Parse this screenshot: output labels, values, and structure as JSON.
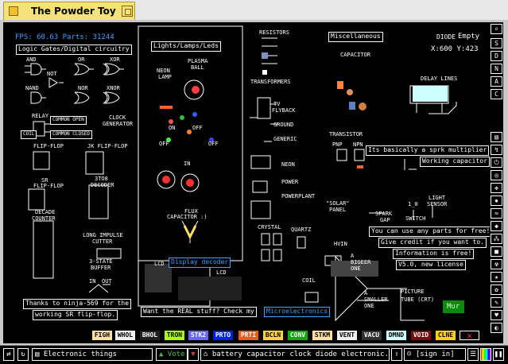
{
  "window": {
    "title": "The Powder Toy"
  },
  "hud": {
    "fps": "FPS: 60.63 Parts: 31244",
    "element_name": "DIODE",
    "hover": "Empty",
    "coords": "X:600 Y:423"
  },
  "labels": {
    "logic": "Logic Gates/Digital circuitry",
    "and": "AND",
    "not": "NOT",
    "or": "OR",
    "xor": "XOR",
    "nand": "NAND",
    "nor": "NOR",
    "xnor": "XNOR",
    "relay": "RELAY",
    "common_open": "COMMON OPEN",
    "common_closed": "COMMON CLOSED",
    "coil": "COIL",
    "clock": "CLOCK",
    "generator": "GENERATOR",
    "flipflop": "FLIP-FLOP",
    "jk": "JK FLIP-FLOP",
    "sr": "SR",
    "sr2": "FLIP-FLOP",
    "decoder": "3TO8",
    "decoder2": "DECODER",
    "decade": "DECADE",
    "decade2": "COUNTER",
    "long_impulse": "LONG IMPULSE",
    "cutter": "CUTTER",
    "tristate": "3-STATE",
    "buffer": "BUFFER",
    "in": "IN",
    "out": "OUT",
    "thanks": "Thanks to ninja-569 for the",
    "working_sr": "working SR flip-flop.",
    "lights": "Lights/Lamps/Leds",
    "neon_lamp": "NEON",
    "neon_lamp2": "LAMP",
    "plasma": "PLASMA",
    "plasma2": "BALL",
    "on": "ON",
    "off": "OFF",
    "flux": "FLUX",
    "flux2": "CAPACITOR :)",
    "lcd": "LCD",
    "display_decoder": "Display decoder",
    "want": "Want the REAL stuff? Check my",
    "micro": "Microelectronics",
    "resistors": "RESISTORS",
    "transformers": "TRANSFORMERS",
    "tv": "TV",
    "flyback": "FLYBACK",
    "ground": "GROUND",
    "generic": "GENERIC",
    "neon": "NEON",
    "power": "POWER",
    "powerplant": "POWERPLANT",
    "crystal": "CRYSTAL",
    "quartz": "QUARTZ",
    "misc": "Miscellaneous",
    "capacitor": "CAPACITOR",
    "delay": "DELAY LINES",
    "transistor": "TRANSISTOR",
    "pnp": "PNP",
    "npn": "NPN",
    "sprk": "Its basically a sprk multiplier",
    "working_cap": "Working capacitor",
    "solar": "\"SOLAR\"",
    "panel": "PANEL",
    "spark": "SPARK",
    "gap": "GAP",
    "switch": "SWITCH",
    "one_zero": "1_0",
    "light": "LIGHT",
    "sensor": "SENSOR",
    "free": "You can use any parts for free!",
    "credit": "Give credit if you want to.",
    "info": "Information is free!",
    "v5": "V5.0, new license",
    "hvin": "HVIN",
    "bigger": "A",
    "bigger2": "BIGEER",
    "bigger3": "ONE",
    "smaller": "A",
    "smaller2": "SMALLER",
    "smaller3": "ONE",
    "coil2": "COIL",
    "picture": "PICTURE",
    "tube": "TUBE (CRT)",
    "mur": "Mur"
  },
  "elements": [
    {
      "name": "FIGH",
      "bg": "#ffe0a0",
      "fg": "#000"
    },
    {
      "name": "WHOL",
      "bg": "#efefef",
      "fg": "#000"
    },
    {
      "name": "BHOL",
      "bg": "#202020",
      "fg": "#fff"
    },
    {
      "name": "TRON",
      "bg": "#a9ff00",
      "fg": "#000"
    },
    {
      "name": "STK2",
      "bg": "#6464ff",
      "fg": "#fff"
    },
    {
      "name": "PRTO",
      "bg": "#0020eb",
      "fg": "#fff"
    },
    {
      "name": "PRTI",
      "bg": "#eb5917",
      "fg": "#fff"
    },
    {
      "name": "BCLN",
      "bg": "#ffd040",
      "fg": "#000"
    },
    {
      "name": "CONV",
      "bg": "#0aab0a",
      "fg": "#fff"
    },
    {
      "name": "STKM",
      "bg": "#ffe0a0",
      "fg": "#000"
    },
    {
      "name": "VENT",
      "bg": "#efefef",
      "fg": "#000"
    },
    {
      "name": "VACU",
      "bg": "#303030",
      "fg": "#fff"
    },
    {
      "name": "DMND",
      "bg": "#ccffff",
      "fg": "#000"
    },
    {
      "name": "VOID",
      "bg": "#790b0b",
      "fg": "#fff"
    },
    {
      "name": "CLNE",
      "bg": "#ffd010",
      "fg": "#000"
    }
  ],
  "sidebar": {
    "letters": [
      "S",
      "D",
      "N",
      "A",
      "C"
    ]
  },
  "status": {
    "save_name": "Electronic things",
    "vote": "Vote",
    "tags": "battery capacitor clock diode electronic...",
    "signin": "[sign in]"
  },
  "colors": {
    "accent_blue": "#40a0ff",
    "wire": "#ffffff"
  }
}
